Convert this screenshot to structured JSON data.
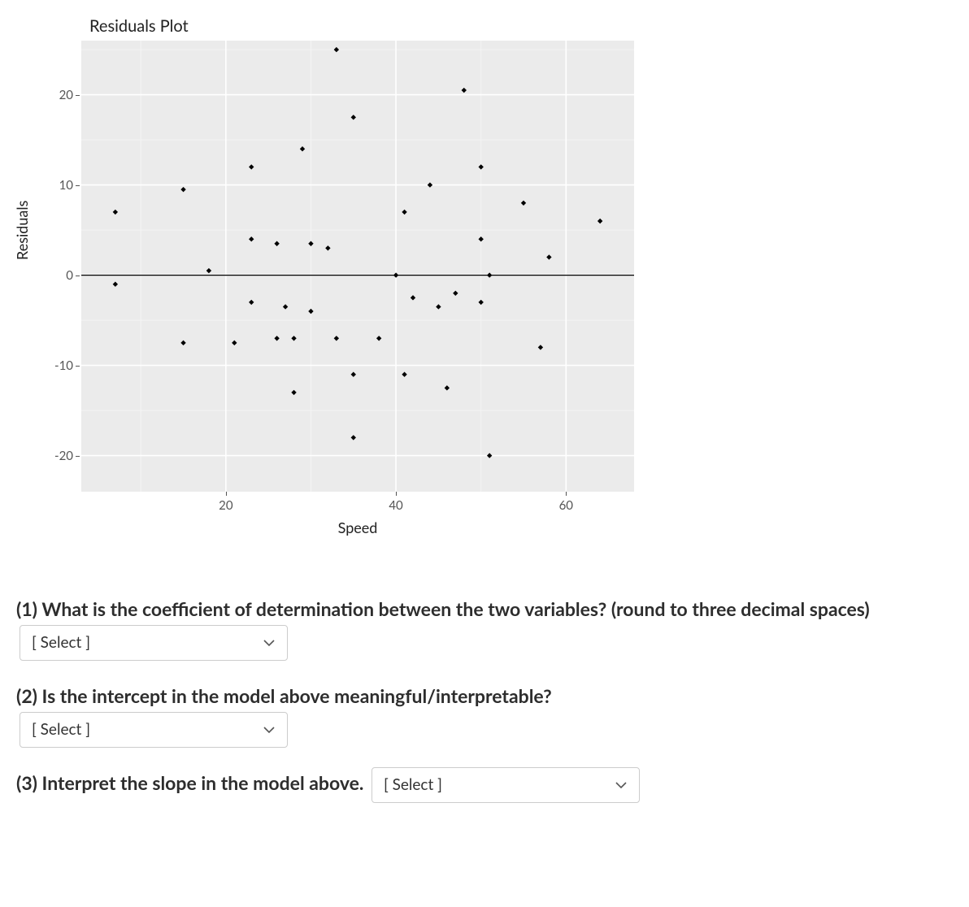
{
  "chart_data": {
    "type": "scatter",
    "title": "Residuals Plot",
    "xlabel": "Speed",
    "ylabel": "Residuals",
    "xlim": [
      3,
      68
    ],
    "ylim": [
      -24,
      26
    ],
    "x_ticks": [
      20,
      40,
      60
    ],
    "y_ticks": [
      -20,
      -10,
      0,
      10,
      20
    ],
    "zero_line_y": 0,
    "points": [
      {
        "x": 7,
        "y": 7
      },
      {
        "x": 7,
        "y": -1
      },
      {
        "x": 15,
        "y": 9.5
      },
      {
        "x": 15,
        "y": -7.5
      },
      {
        "x": 18,
        "y": 0.5
      },
      {
        "x": 21,
        "y": -7.5
      },
      {
        "x": 23,
        "y": 12
      },
      {
        "x": 23,
        "y": 4
      },
      {
        "x": 23,
        "y": -3
      },
      {
        "x": 26,
        "y": 3.5
      },
      {
        "x": 26,
        "y": -7
      },
      {
        "x": 27,
        "y": -3.5
      },
      {
        "x": 28,
        "y": -7
      },
      {
        "x": 28,
        "y": -13
      },
      {
        "x": 29,
        "y": 14
      },
      {
        "x": 30,
        "y": 3.5
      },
      {
        "x": 30,
        "y": -4
      },
      {
        "x": 32,
        "y": 3
      },
      {
        "x": 33,
        "y": 25
      },
      {
        "x": 33,
        "y": -7
      },
      {
        "x": 35,
        "y": 17.5
      },
      {
        "x": 35,
        "y": -11
      },
      {
        "x": 35,
        "y": -18
      },
      {
        "x": 38,
        "y": -7
      },
      {
        "x": 40,
        "y": 0
      },
      {
        "x": 41,
        "y": 7
      },
      {
        "x": 41,
        "y": -11
      },
      {
        "x": 42,
        "y": -2.5
      },
      {
        "x": 44,
        "y": 10
      },
      {
        "x": 45,
        "y": -3.5
      },
      {
        "x": 46,
        "y": -12.5
      },
      {
        "x": 47,
        "y": -2
      },
      {
        "x": 48,
        "y": 20.5
      },
      {
        "x": 50,
        "y": 12
      },
      {
        "x": 50,
        "y": 4
      },
      {
        "x": 50,
        "y": -3
      },
      {
        "x": 51,
        "y": 0
      },
      {
        "x": 51,
        "y": -20
      },
      {
        "x": 55,
        "y": 8
      },
      {
        "x": 57,
        "y": -8
      },
      {
        "x": 64,
        "y": 6
      },
      {
        "x": 58,
        "y": 2
      }
    ]
  },
  "questions": {
    "q1_text_a": "(1) What is the coefficient of determination between the two variables? (round to three decimal spaces)",
    "q2_text": "(2) Is the intercept in the model above meaningful/interpretable?",
    "q3_text": "(3) Interpret the slope in the model above.",
    "select_placeholder": "[ Select ]"
  }
}
